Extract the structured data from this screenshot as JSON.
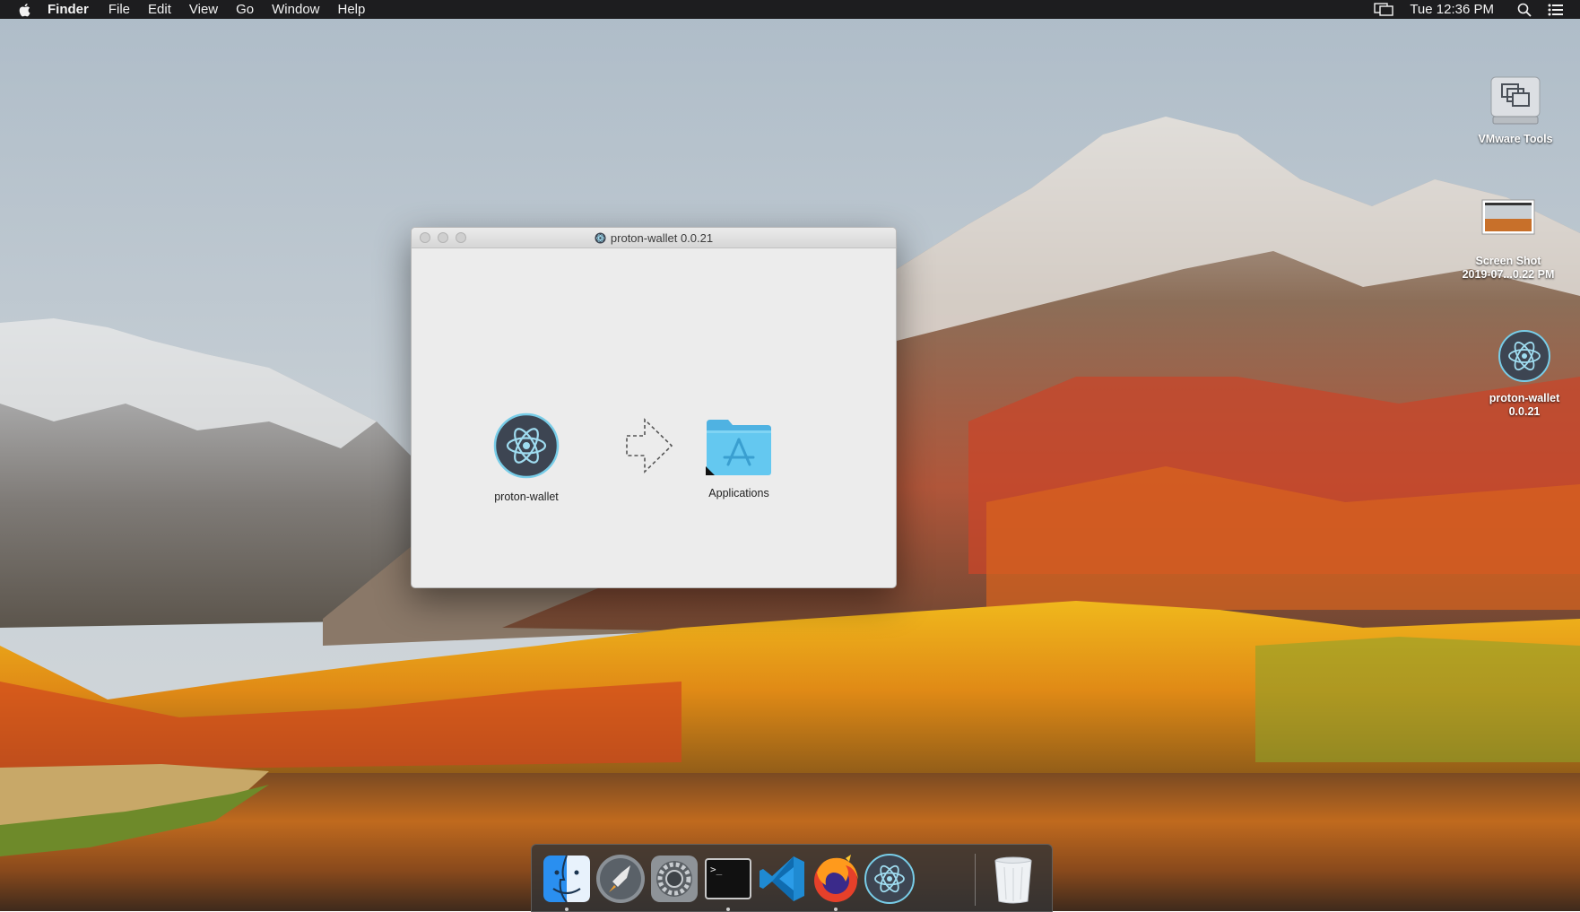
{
  "menubar": {
    "app_name": "Finder",
    "menus": [
      "File",
      "Edit",
      "View",
      "Go",
      "Window",
      "Help"
    ],
    "clock": "Tue 12:36 PM",
    "icons": [
      "apple-icon",
      "display-mirroring-icon",
      "spotlight-icon",
      "notification-center-icon"
    ]
  },
  "desktop": {
    "icons": [
      {
        "label_lines": [
          "VMware Tools"
        ],
        "icon": "disk-drive-icon"
      },
      {
        "label_lines": [
          "Screen Shot",
          "2019-07...0.22 PM"
        ],
        "icon": "screenshot-thumbnail-icon"
      },
      {
        "label_lines": [
          "proton-wallet",
          "0.0.21"
        ],
        "icon": "electron-atom-icon"
      }
    ]
  },
  "window": {
    "title": "proton-wallet 0.0.21",
    "items": {
      "app": {
        "label": "proton-wallet",
        "icon": "electron-atom-icon"
      },
      "arrow": {
        "icon": "dashed-arrow-icon"
      },
      "applications": {
        "label": "Applications",
        "icon": "applications-folder-icon"
      }
    }
  },
  "dock": {
    "apps": [
      "Finder",
      "Launchpad",
      "System Preferences",
      "Terminal",
      "Visual Studio Code",
      "Firefox",
      "proton-wallet",
      "Trash"
    ]
  },
  "colors": {
    "menubar_bg": "#1d1d1f",
    "window_bg": "#ececec",
    "folder_blue": "#64c8f0",
    "electron_bg": "#3d4552",
    "electron_accent": "#78cde8"
  }
}
